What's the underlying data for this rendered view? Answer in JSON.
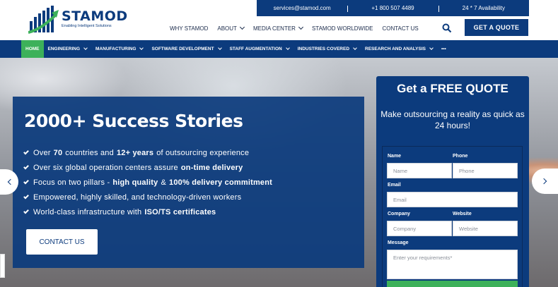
{
  "brand": {
    "name": "STAMOD",
    "tagline": "Enabling Intelligent Solutions",
    "colors": {
      "primary": "#0c3b7d",
      "accent": "#3db15a"
    }
  },
  "topbar": {
    "email": "services@stamod.com",
    "phone": "+1 800 507 4489",
    "availability": "24 * 7 Availability"
  },
  "main_nav": {
    "items": [
      {
        "label": "WHY STAMOD",
        "dropdown": false
      },
      {
        "label": "ABOUT",
        "dropdown": true
      },
      {
        "label": "MEDIA CENTER",
        "dropdown": true
      },
      {
        "label": "STAMOD WORLDWIDE",
        "dropdown": false
      },
      {
        "label": "CONTACT US",
        "dropdown": false
      }
    ],
    "search_icon": "search-icon",
    "cta": "GET A QUOTE"
  },
  "sub_nav": {
    "items": [
      {
        "label": "HOME",
        "active": true,
        "dropdown": false
      },
      {
        "label": "ENGINEERING",
        "dropdown": true
      },
      {
        "label": "MANUFACTURING",
        "dropdown": true
      },
      {
        "label": "SOFTWARE DEVELOPMENT",
        "dropdown": true
      },
      {
        "label": "STAFF AUGMENTATION",
        "dropdown": true
      },
      {
        "label": "INDUSTRIES COVERED",
        "dropdown": true
      },
      {
        "label": "RESEARCH AND ANALYSIS",
        "dropdown": true
      },
      {
        "label": "•••",
        "dropdown": false
      }
    ]
  },
  "hero": {
    "title": "2000+ Success Stories",
    "features": [
      {
        "pre": "Over",
        "bold": "70",
        "mid": "countries and",
        "bold2": "12+ years",
        "post": "of outsourcing experience"
      },
      {
        "pre": "Over six global operation centers assure",
        "bold": "on-time delivery",
        "mid": "",
        "bold2": "",
        "post": ""
      },
      {
        "pre": "Focus on two pillars -",
        "bold": "high quality",
        "mid": "&",
        "bold2": "100% delivery commitment",
        "post": ""
      },
      {
        "pre": "Empowered, highly skilled, and technology-driven workers",
        "bold": "",
        "mid": "",
        "bold2": "",
        "post": ""
      },
      {
        "pre": "World-class infrastructure with",
        "bold": "ISO/TS certificates",
        "mid": "",
        "bold2": "",
        "post": ""
      }
    ],
    "cta": "CONTACT US"
  },
  "quote_form": {
    "title": "Get a FREE QUOTE",
    "subtitle": "Make outsourcing a reality as quick as 24 hours!",
    "fields": {
      "name": {
        "label": "Name",
        "placeholder": "Name"
      },
      "phone": {
        "label": "Phone",
        "placeholder": "Phone"
      },
      "email": {
        "label": "Email",
        "placeholder": "Email"
      },
      "company": {
        "label": "Company",
        "placeholder": "Company"
      },
      "website": {
        "label": "Website",
        "placeholder": "Website"
      },
      "message": {
        "label": "Message",
        "placeholder": "Enter your requirements*"
      }
    }
  }
}
